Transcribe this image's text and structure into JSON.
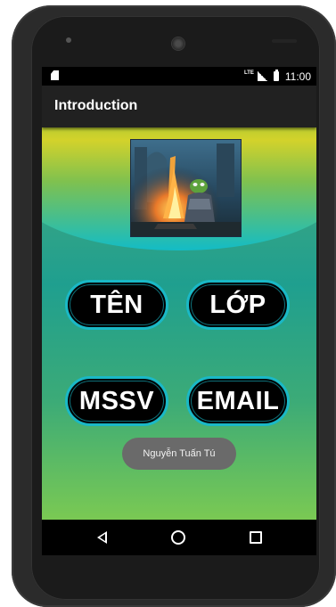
{
  "status_bar": {
    "network": "LTE",
    "time": "11:00"
  },
  "app_bar": {
    "title": "Introduction"
  },
  "buttons": {
    "ten": "TÊN",
    "lop": "LỚP",
    "mssv": "MSSV",
    "email": "EMAIL"
  },
  "toast": {
    "message": "Nguyễn Tuấn Tú"
  },
  "colors": {
    "app_bar": "#212121",
    "button_border": "#1ab8c6",
    "toast_bg": "#6a6a6a"
  },
  "icons": {
    "status": [
      "sd-card-icon",
      "signal-icon",
      "battery-icon"
    ],
    "nav": [
      "back-icon",
      "home-icon",
      "recents-icon"
    ]
  }
}
